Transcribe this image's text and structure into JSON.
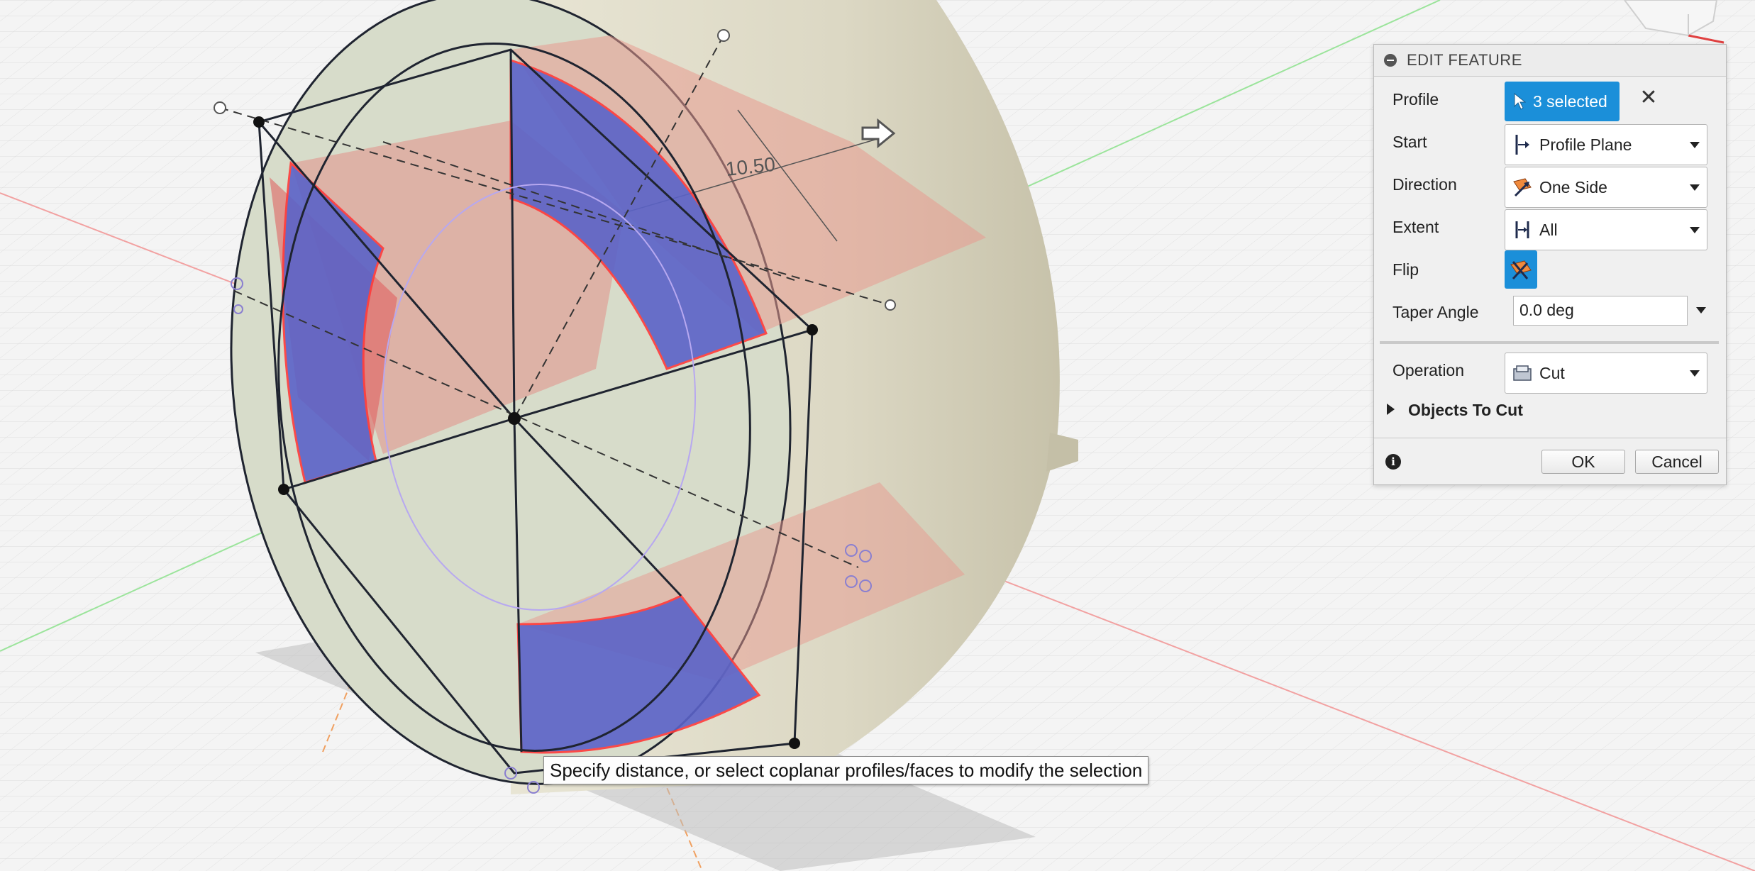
{
  "viewport": {
    "dimension_label": "10.50"
  },
  "panel": {
    "title": "EDIT FEATURE",
    "profile": {
      "label": "Profile",
      "value": "3 selected",
      "icon": "select-cursor-icon"
    },
    "start": {
      "label": "Start",
      "value": "Profile Plane",
      "icon": "profile-plane-icon"
    },
    "direction": {
      "label": "Direction",
      "value": "One Side",
      "icon": "one-side-icon"
    },
    "extent": {
      "label": "Extent",
      "value": "All",
      "icon": "extent-all-icon"
    },
    "flip": {
      "label": "Flip",
      "icon": "flip-icon"
    },
    "taper": {
      "label": "Taper Angle",
      "value": "0.0 deg"
    },
    "operation": {
      "label": "Operation",
      "value": "Cut",
      "icon": "cut-icon"
    },
    "objects_to_cut": {
      "label": "Objects To Cut"
    },
    "ok_label": "OK",
    "cancel_label": "Cancel"
  },
  "tooltip": {
    "text": "Specify distance, or select coplanar profiles/faces to modify the selection"
  },
  "colors": {
    "accent": "#1b8fd9",
    "profile_blue": "#5b63c8",
    "preview_red": "#e8908a",
    "body": "#d8d4c0"
  }
}
